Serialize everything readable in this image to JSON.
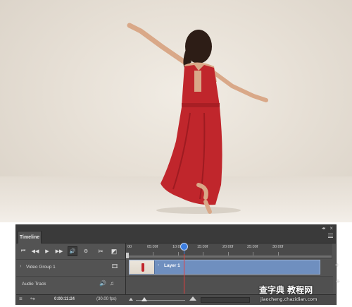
{
  "panel": {
    "tab_label": "Timeline",
    "collapse_glyph": "◂◂",
    "close_glyph": "×"
  },
  "controls": {
    "first_frame_glyph": "⏮",
    "prev_frame_glyph": "◀◀",
    "play_glyph": "▶",
    "next_frame_glyph": "▶▶",
    "audio_glyph": "🔊",
    "settings_glyph": "⚙",
    "split_glyph": "✂",
    "transition_glyph": "◩"
  },
  "ruler": {
    "ticks": [
      "00",
      "05:00f",
      "10:00f",
      "15:00f",
      "20:00f",
      "25:00f",
      "30:00f"
    ]
  },
  "tracks": {
    "video_group": {
      "chevron": "›",
      "label": "Video Group 1",
      "film_icon": "🎞"
    },
    "audio": {
      "label": "Audio Track",
      "speaker_icon": "🔊",
      "note_icon": "♫"
    },
    "clip_label": "Layer 1",
    "add_glyph": "+"
  },
  "bottombar": {
    "render_icon": "≡",
    "convert_icon": "↪",
    "timecode": "0:00:11:24",
    "fps": "(30.00 fps)"
  },
  "watermark": {
    "logo_text": "查字典 教程网",
    "url_text": "jiaocheng.chazidian.com"
  },
  "colors": {
    "panel_bg": "#535353",
    "clip_blue": "#6f8fbf",
    "playhead_red": "#e83c3c",
    "playhead_knob": "#3b7de0",
    "dress_red": "#c0262c"
  }
}
